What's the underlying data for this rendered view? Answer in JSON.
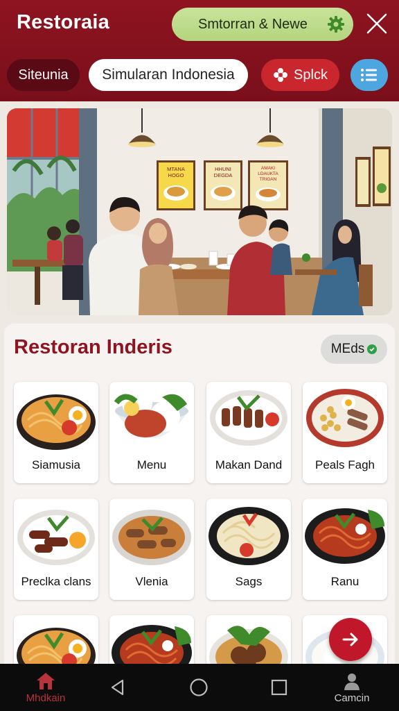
{
  "header": {
    "app_title": "Restoraia",
    "promo_label": "Smtorran & Newe",
    "chips": [
      "Siteunia",
      "Simularan Indonesia",
      "Splck"
    ],
    "colors": {
      "brand": "#8e1420",
      "promo": "#bcdc88",
      "accent_blue": "#4ea6e0"
    }
  },
  "hero": {
    "posters": [
      {
        "line1": "MTANA",
        "line2": "HOGO"
      },
      {
        "line1": "HHUNI",
        "line2": "DEGDA"
      },
      {
        "line1": "AMAKI",
        "line2": "LDAUKTA",
        "line3": "TRIGAN"
      }
    ]
  },
  "panel": {
    "title": "Restoran Inderis",
    "meds_label": "MEds",
    "items": [
      {
        "label": "Siamusia",
        "dish": "noodle-egg"
      },
      {
        "label": "Menu",
        "dish": "rice-bowl"
      },
      {
        "label": "Makan Dand",
        "dish": "satay-plate"
      },
      {
        "label": "Peals Fagh",
        "dish": "chickpea-rice"
      },
      {
        "label": "Preclka clans",
        "dish": "sausage-plate"
      },
      {
        "label": "Vlenia",
        "dish": "stew-plate"
      },
      {
        "label": "Sags",
        "dish": "pasta-plate"
      },
      {
        "label": "Ranu",
        "dish": "spicy-noodle"
      },
      {
        "label": "",
        "dish": "noodle-egg"
      },
      {
        "label": "",
        "dish": "spicy-noodle"
      },
      {
        "label": "",
        "dish": "beef-greens"
      },
      {
        "label": "",
        "dish": "rice-plate"
      }
    ]
  },
  "nav": {
    "items": [
      {
        "label": "Mhdkain",
        "icon": "home-icon"
      },
      {
        "label": "",
        "icon": "back-triangle-icon"
      },
      {
        "label": "",
        "icon": "home-circle-icon"
      },
      {
        "label": "",
        "icon": "recents-square-icon"
      },
      {
        "label": "Camcin",
        "icon": "person-icon"
      }
    ],
    "active_color": "#b8333c"
  }
}
